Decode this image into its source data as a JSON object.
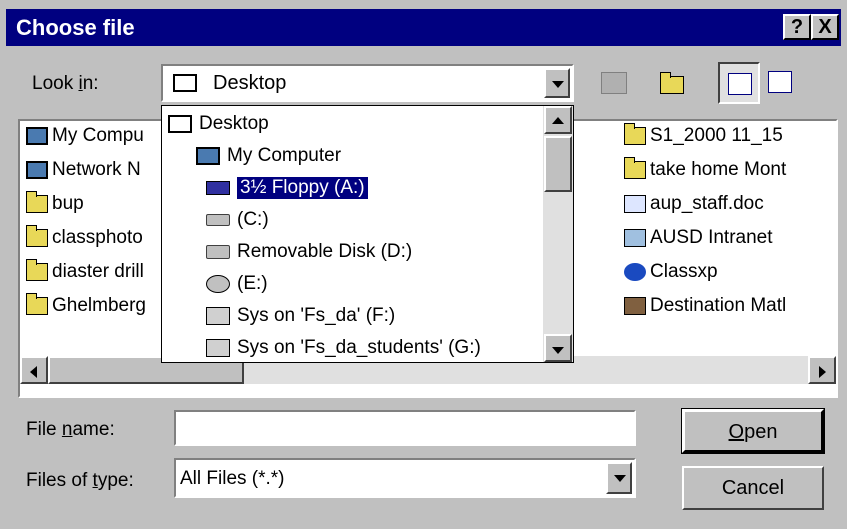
{
  "window": {
    "title": "Choose file",
    "help_label": "?",
    "close_label": "X"
  },
  "look_in": {
    "label_pre": "Look ",
    "label_u": "i",
    "label_post": "n:",
    "value": "Desktop"
  },
  "toolbar": {
    "up_icon": "up-one-level-icon",
    "new_folder_icon": "new-folder-icon",
    "list_icon": "list-view-icon",
    "details_icon": "details-view-icon"
  },
  "dropdown": {
    "items": [
      {
        "label": "Desktop",
        "icon": "desktop-icon"
      },
      {
        "label": "My Computer",
        "icon": "computer-icon"
      },
      {
        "label": "3½ Floppy (A:)",
        "icon": "floppy-icon",
        "selected": true
      },
      {
        "label": "(C:)",
        "icon": "hard-drive-icon"
      },
      {
        "label": "Removable Disk (D:)",
        "icon": "removable-disk-icon"
      },
      {
        "label": "(E:)",
        "icon": "cd-drive-icon"
      },
      {
        "label": "Sys on 'Fs_da' (F:)",
        "icon": "network-drive-icon"
      },
      {
        "label": "Sys on 'Fs_da_students' (G:)",
        "icon": "network-drive-icon"
      }
    ]
  },
  "files_left": [
    {
      "label": "My Compu",
      "icon": "computer-icon"
    },
    {
      "label": "Network N",
      "icon": "network-icon"
    },
    {
      "label": "bup",
      "icon": "folder-icon"
    },
    {
      "label": "classphoto",
      "icon": "folder-icon"
    },
    {
      "label": "diaster drill",
      "icon": "folder-icon"
    },
    {
      "label": "Ghelmberg",
      "icon": "folder-icon"
    }
  ],
  "files_right": [
    {
      "label": "S1_2000 11_15",
      "icon": "folder-icon"
    },
    {
      "label": "take home Mont",
      "icon": "folder-icon"
    },
    {
      "label": "aup_staff.doc",
      "icon": "word-document-icon"
    },
    {
      "label": "AUSD Intranet",
      "icon": "shortcut-icon"
    },
    {
      "label": "Classxp",
      "icon": "frontpage-icon"
    },
    {
      "label": "Destination Matl",
      "icon": "application-icon"
    }
  ],
  "file_name": {
    "label_pre": "File ",
    "label_u": "n",
    "label_post": "ame:",
    "value": ""
  },
  "file_type": {
    "label_pre": "Files of ",
    "label_u": "t",
    "label_post": "ype:",
    "value": "All Files (*.*)"
  },
  "buttons": {
    "open_u": "O",
    "open_rest": "pen",
    "cancel": "Cancel"
  }
}
